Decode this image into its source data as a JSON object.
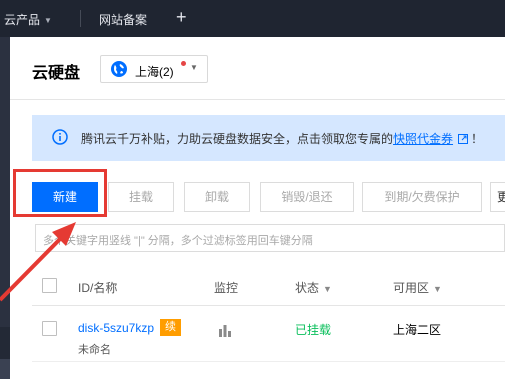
{
  "topbar": {
    "products_label": "云产品",
    "icp_label": "网站备案",
    "add_label": "+"
  },
  "header": {
    "title": "云硬盘",
    "region": "上海(2)"
  },
  "notice": {
    "text": "腾讯云千万补贴，力助云硬盘数据安全，点击领取您专属的",
    "link": "快照代金券",
    "suffix": "！"
  },
  "toolbar": {
    "new": "新建",
    "mount": "挂载",
    "unmount": "卸载",
    "destroy": "销毁/退还",
    "expire": "到期/欠费保护",
    "more": "更"
  },
  "filter": {
    "placeholder": "多个关键字用竖线 \"|\" 分隔，多个过滤标签用回车键分隔"
  },
  "table": {
    "columns": [
      "ID/名称",
      "监控",
      "状态",
      "可用区"
    ],
    "rows": [
      {
        "id": "disk-5szu7kzp",
        "renew": "续",
        "name": "未命名",
        "status": "已挂载",
        "zone": "上海二区"
      }
    ]
  },
  "colors": {
    "primary": "#006eff",
    "nav_bg": "#1f2531",
    "notice_bg": "#d5e7ff",
    "status_green": "#0abf5b",
    "renew_orange": "#ff9d00",
    "annotation_red": "#e53a33"
  }
}
